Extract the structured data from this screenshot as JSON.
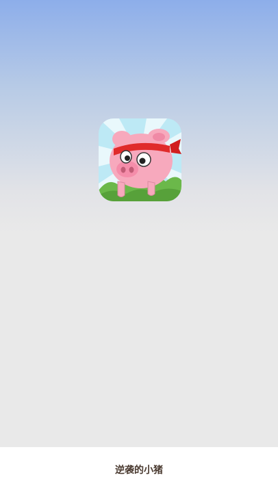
{
  "splash": {
    "icon": "pig-headband-icon",
    "app_name": "逆袭的小猪"
  }
}
